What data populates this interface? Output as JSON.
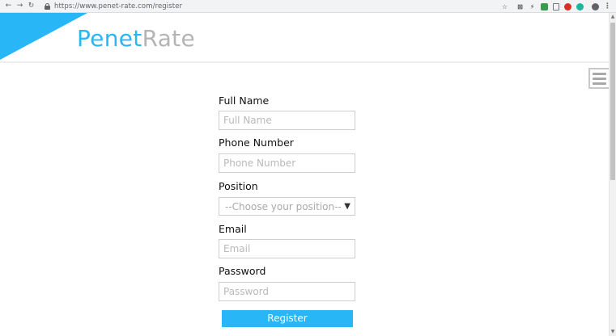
{
  "browser": {
    "url": "https://www.penet-rate.com/register",
    "nav_icons": [
      "back-arrow-icon",
      "forward-arrow-icon",
      "reload-icon"
    ],
    "extensions": [
      "bookmark-star-icon",
      "x-extension-icon",
      "bolt-extension-icon",
      "green-extension-icon",
      "page-extension-icon",
      "red-extension-icon",
      "teal-extension-icon",
      "account-icon",
      "kebab-menu-icon"
    ],
    "glyphs": {
      "back": "←",
      "forward": "→",
      "reload": "↻",
      "star": "☆",
      "x": "⊠",
      "bolt": "⚡",
      "kebab": "⋮"
    }
  },
  "brand": {
    "name_part1": "Penet",
    "name_part2": "Rate",
    "accent_color": "#29b6f6",
    "secondary_color": "#b4b4b4"
  },
  "menu": {
    "icon": "hamburger-menu-icon"
  },
  "form": {
    "full_name": {
      "label": "Full Name",
      "placeholder": "Full Name",
      "value": ""
    },
    "phone": {
      "label": "Phone Number",
      "placeholder": "Phone Number",
      "value": ""
    },
    "position": {
      "label": "Position",
      "selected": "--Choose your position--",
      "arrow": "▼"
    },
    "email": {
      "label": "Email",
      "placeholder": "Email",
      "value": ""
    },
    "password": {
      "label": "Password",
      "placeholder": "Password",
      "value": ""
    },
    "submit_label": "Register"
  },
  "scrollbar": {
    "up": "▲",
    "down": "▼"
  }
}
